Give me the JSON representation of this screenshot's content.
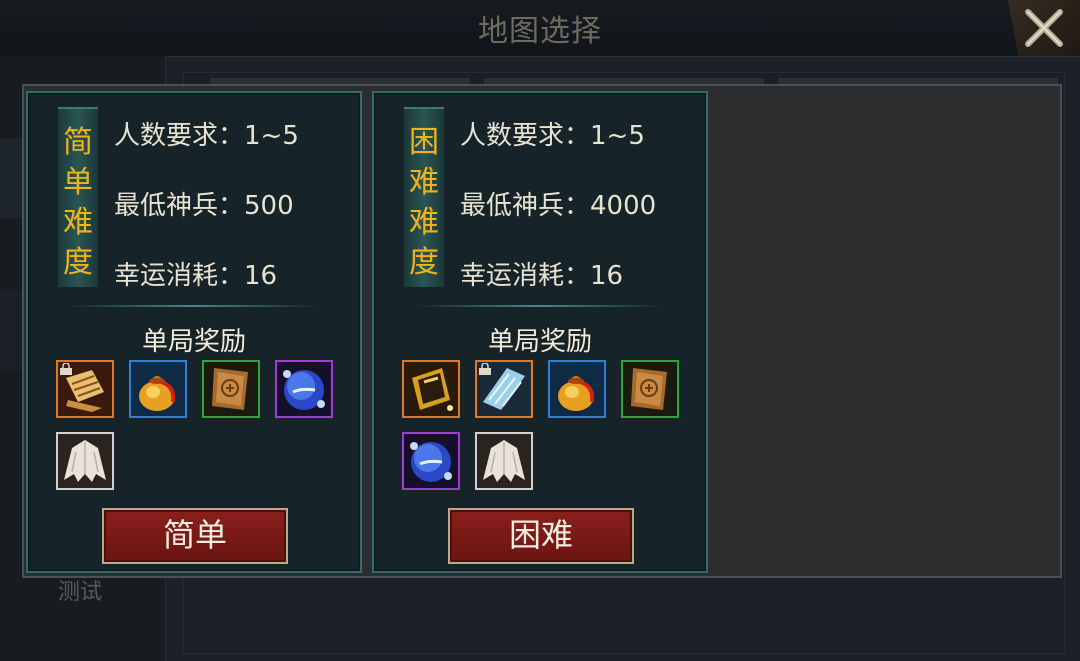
{
  "window": {
    "title": "地图选择",
    "sidebar_bg_label": "测试"
  },
  "cards": [
    {
      "difficulty": [
        "简",
        "单",
        "难",
        "度"
      ],
      "requirements": {
        "players": "人数要求：1~5",
        "min_weapon": "最低神兵：500",
        "luck_cost": "幸运消耗：16"
      },
      "reward_title": "单局奖励",
      "items": [
        {
          "icon": "ingot-scroll-icon",
          "quality": "orange",
          "locked": true
        },
        {
          "icon": "gold-pouch-icon",
          "quality": "blue",
          "locked": false
        },
        {
          "icon": "ancient-scroll-icon",
          "quality": "green",
          "locked": false
        },
        {
          "icon": "blue-orb-icon",
          "quality": "purple",
          "locked": false
        },
        {
          "icon": "white-fur-icon",
          "quality": "white",
          "locked": false
        }
      ],
      "button_label": "简单"
    },
    {
      "difficulty": [
        "困",
        "难",
        "难",
        "度"
      ],
      "requirements": {
        "players": "人数要求：1~5",
        "min_weapon": "最低神兵：4000",
        "luck_cost": "幸运消耗：16"
      },
      "reward_title": "单局奖励",
      "items": [
        {
          "icon": "golden-frame-icon",
          "quality": "orange",
          "locked": false
        },
        {
          "icon": "ice-crystal-icon",
          "quality": "orange",
          "locked": true
        },
        {
          "icon": "gold-pouch-icon",
          "quality": "blue",
          "locked": false
        },
        {
          "icon": "ancient-scroll-icon",
          "quality": "green",
          "locked": false
        },
        {
          "icon": "blue-orb-icon",
          "quality": "purple",
          "locked": false
        },
        {
          "icon": "white-fur-icon",
          "quality": "white",
          "locked": false
        }
      ],
      "button_label": "困难"
    }
  ],
  "colors": {
    "difficulty_text": "#f0b418",
    "card_border": "#2d6d6e",
    "button_red": "#8a1f1c"
  }
}
